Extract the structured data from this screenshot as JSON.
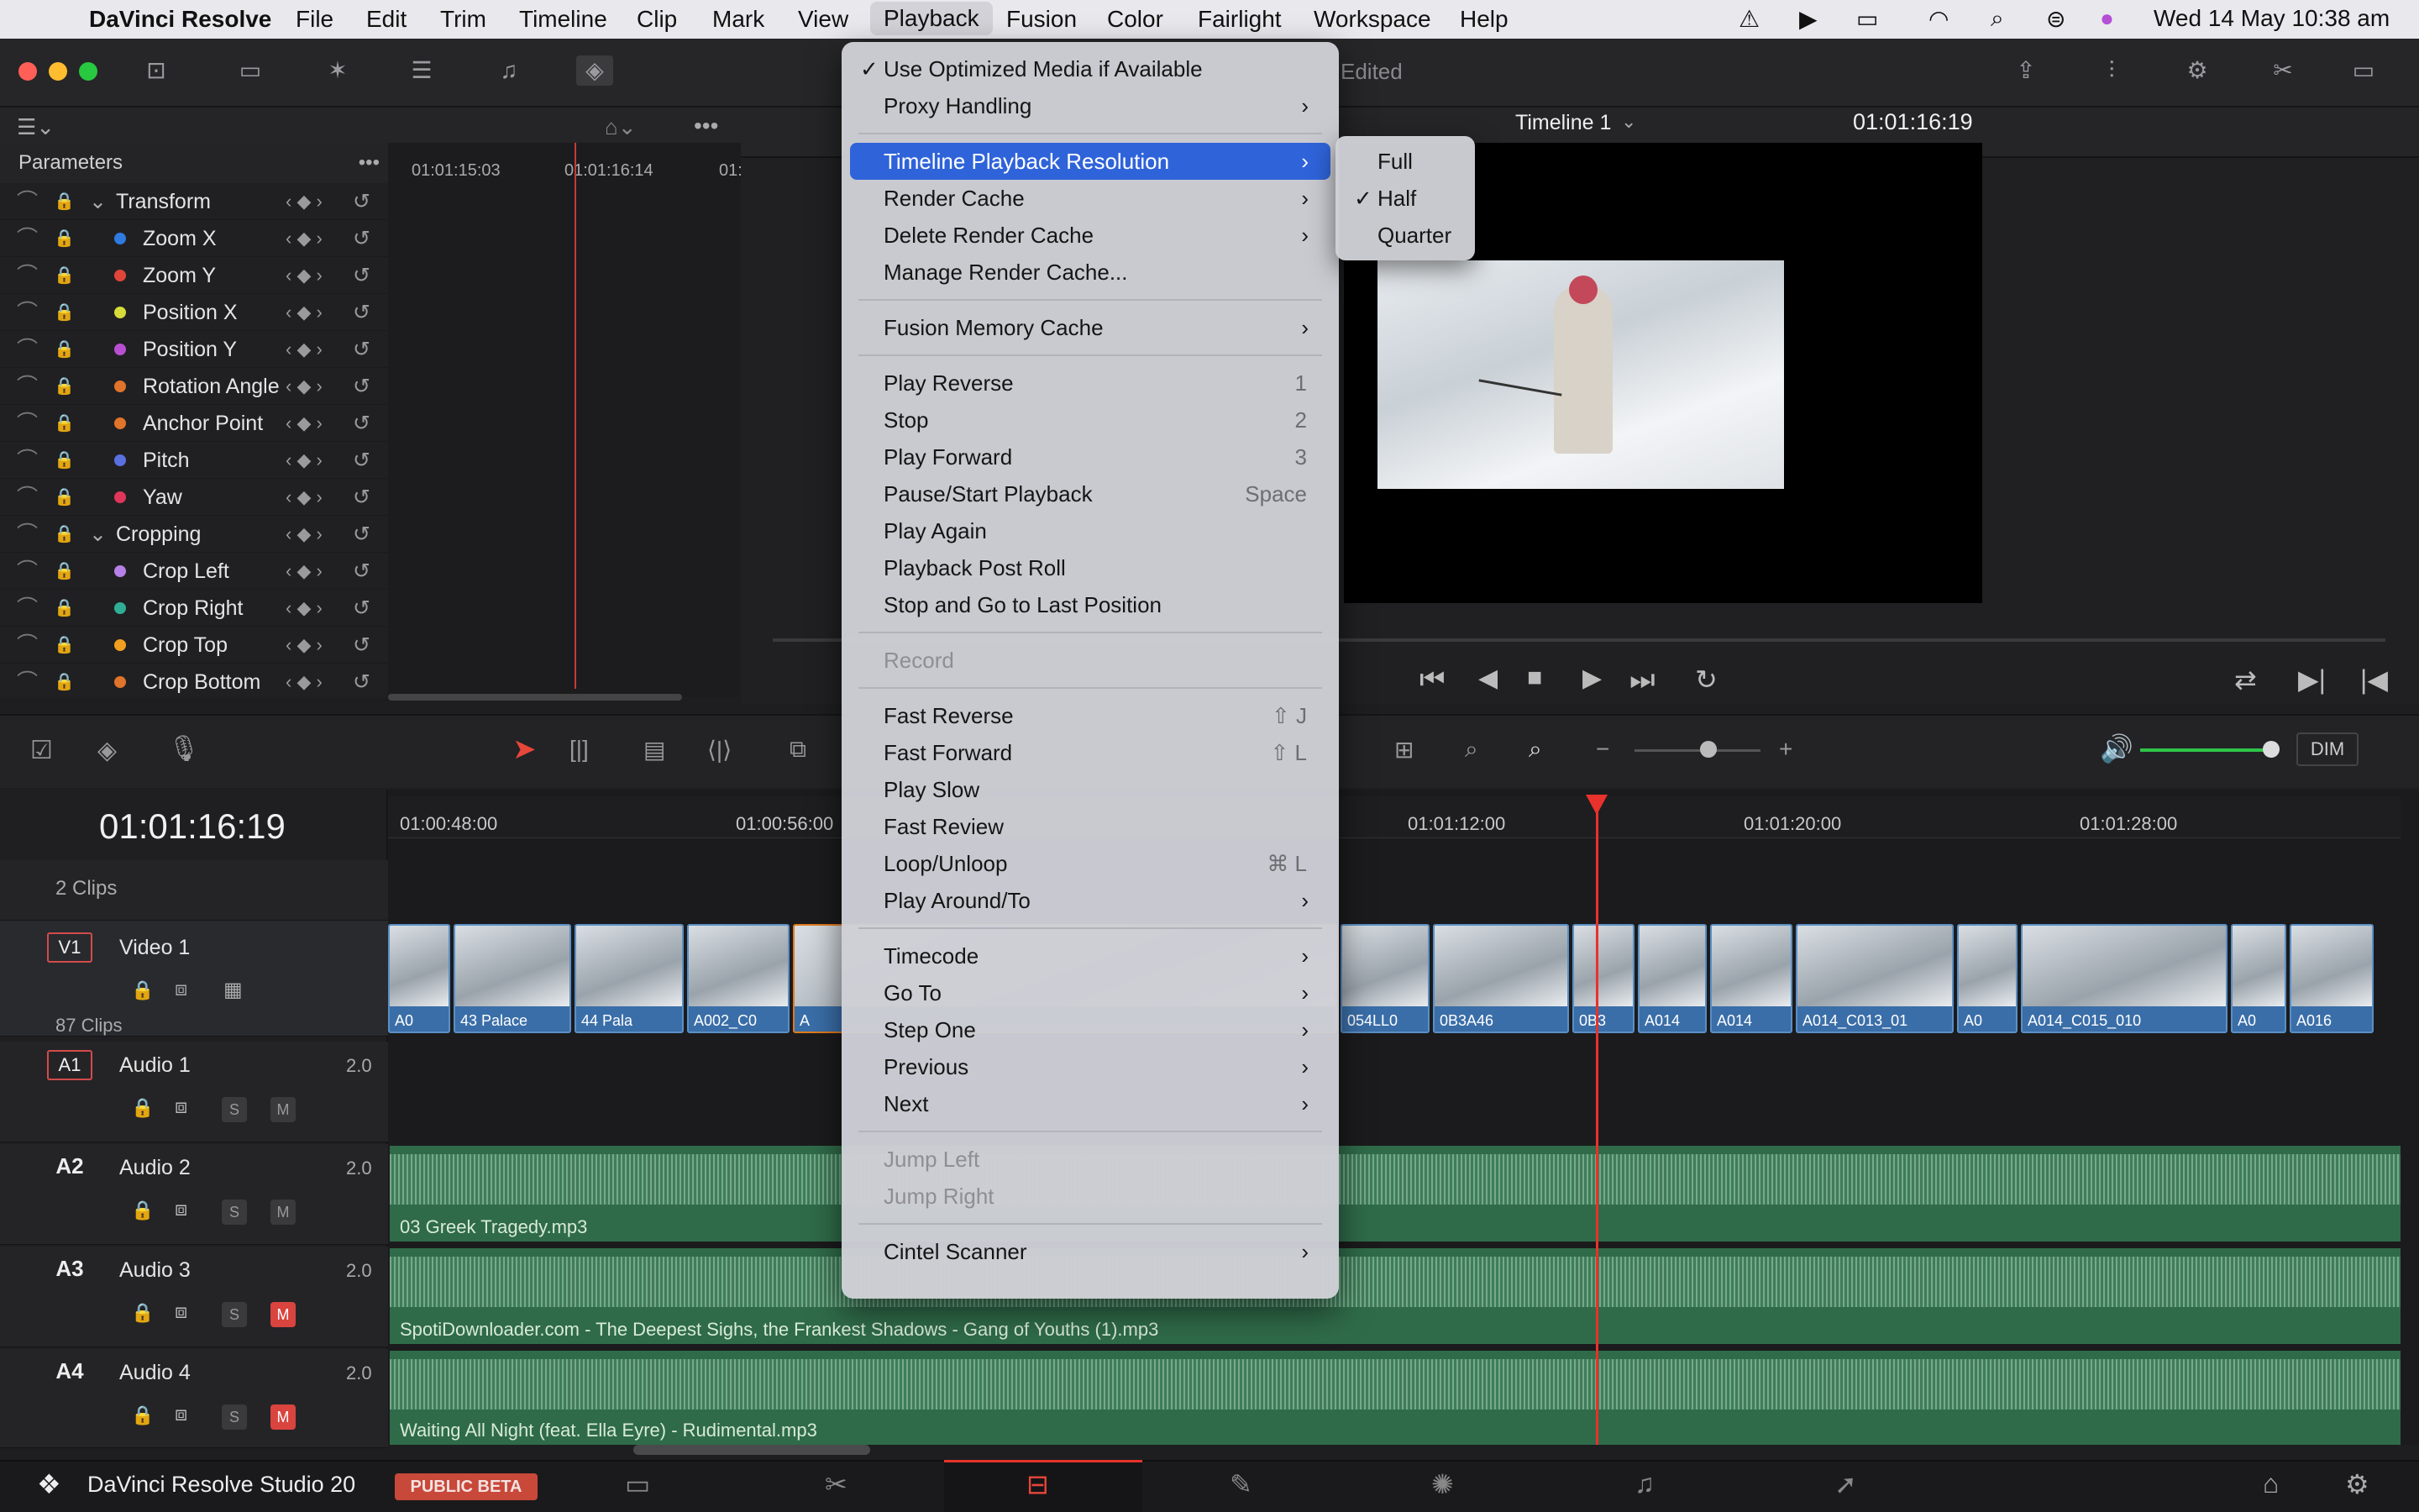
{
  "menubar": {
    "app": "DaVinci Resolve",
    "items": [
      "File",
      "Edit",
      "Trim",
      "Timeline",
      "Clip",
      "Mark",
      "View",
      "Playback",
      "Fusion",
      "Color",
      "Fairlight",
      "Workspace",
      "Help"
    ],
    "clock": "Wed 14 May  10:38 am"
  },
  "window": {
    "edited": "Edited",
    "timeline_name": "Timeline 1",
    "viewer_tc": "01:01:16:19"
  },
  "params": {
    "title": "Parameters",
    "ruler": [
      "01:01:15:03",
      "01:01:16:14",
      "01:"
    ],
    "rows": [
      {
        "label": "Transform",
        "group": true
      },
      {
        "label": "Zoom X",
        "color": "#2f7be0"
      },
      {
        "label": "Zoom Y",
        "color": "#e0453a"
      },
      {
        "label": "Position X",
        "color": "#d6db3a"
      },
      {
        "label": "Position Y",
        "color": "#b84fd0"
      },
      {
        "label": "Rotation Angle",
        "color": "#e0742a"
      },
      {
        "label": "Anchor Point",
        "color": "#e0742a"
      },
      {
        "label": "Pitch",
        "color": "#5a6fe0"
      },
      {
        "label": "Yaw",
        "color": "#e0365a"
      },
      {
        "label": "Cropping",
        "group": true
      },
      {
        "label": "Crop Left",
        "color": "#b780e6"
      },
      {
        "label": "Crop Right",
        "color": "#2fae95"
      },
      {
        "label": "Crop Top",
        "color": "#f0a020"
      },
      {
        "label": "Crop Bottom",
        "color": "#e0742a"
      }
    ]
  },
  "timeline": {
    "tc": "01:01:16:19",
    "ruler": [
      "01:00:48:00",
      "01:00:56:00",
      "01:01:12:00",
      "01:01:20:00",
      "01:01:28:00"
    ],
    "v1_clips_count": "2 Clips",
    "v1_label": "V1",
    "v1_name": "Video 1",
    "a1_clips_count": "87 Clips",
    "clip_labels": [
      "A0",
      "43 Palace",
      "44 Pala",
      "A002_C0",
      "A",
      "054LL0",
      "0B3A46",
      "0B3",
      "A014",
      "A014",
      "A014_C013_01",
      "A0",
      "A014_C015_010",
      "A0",
      "A016"
    ],
    "audio": [
      {
        "id": "A1",
        "name": "Audio 1",
        "ch": "2.0",
        "file": ""
      },
      {
        "id": "A2",
        "name": "Audio 2",
        "ch": "2.0",
        "file": "03 Greek Tragedy.mp3"
      },
      {
        "id": "A3",
        "name": "Audio 3",
        "ch": "2.0",
        "file": "SpotiDownloader.com - The Deepest Sighs, the Frankest Shadows - Gang of Youths (1).mp3"
      },
      {
        "id": "A4",
        "name": "Audio 4",
        "ch": "2.0",
        "file": "Waiting All Night (feat. Ella Eyre) - Rudimental.mp3"
      }
    ],
    "s": "S",
    "m": "M",
    "dim": "DIM"
  },
  "bottom": {
    "app": "DaVinci Resolve Studio 20",
    "badge": "PUBLIC BETA"
  },
  "menu": {
    "items": [
      {
        "label": "Use Optimized Media if Available",
        "check": "✓"
      },
      {
        "label": "Proxy Handling",
        "arrow": "›"
      },
      {
        "label": "Timeline Playback Resolution",
        "arrow": "›",
        "hl": true
      },
      {
        "label": "Render Cache",
        "arrow": "›"
      },
      {
        "label": "Delete Render Cache",
        "arrow": "›"
      },
      {
        "label": "Manage Render Cache..."
      },
      {
        "label": "Fusion Memory Cache",
        "arrow": "›"
      },
      {
        "label": "Play Reverse",
        "sc": "1"
      },
      {
        "label": "Stop",
        "sc": "2"
      },
      {
        "label": "Play Forward",
        "sc": "3"
      },
      {
        "label": "Pause/Start Playback",
        "sc": "Space"
      },
      {
        "label": "Play Again"
      },
      {
        "label": "Playback Post Roll"
      },
      {
        "label": "Stop and Go to Last Position"
      },
      {
        "label": "Record",
        "dis": true
      },
      {
        "label": "Fast Reverse",
        "sc": "⇧ J"
      },
      {
        "label": "Fast Forward",
        "sc": "⇧ L"
      },
      {
        "label": "Play Slow"
      },
      {
        "label": "Fast Review"
      },
      {
        "label": "Loop/Unloop",
        "sc": "⌘ L"
      },
      {
        "label": "Play Around/To",
        "arrow": "›"
      },
      {
        "label": "Timecode",
        "arrow": "›"
      },
      {
        "label": "Go To",
        "arrow": "›"
      },
      {
        "label": "Step One",
        "arrow": "›"
      },
      {
        "label": "Previous",
        "arrow": "›"
      },
      {
        "label": "Next",
        "arrow": "›"
      },
      {
        "label": "Jump Left",
        "dis": true
      },
      {
        "label": "Jump Right",
        "dis": true
      },
      {
        "label": "Cintel Scanner",
        "arrow": "›"
      }
    ]
  },
  "submenu": {
    "items": [
      {
        "label": "Full"
      },
      {
        "label": "Half",
        "check": "✓"
      },
      {
        "label": "Quarter"
      }
    ]
  }
}
